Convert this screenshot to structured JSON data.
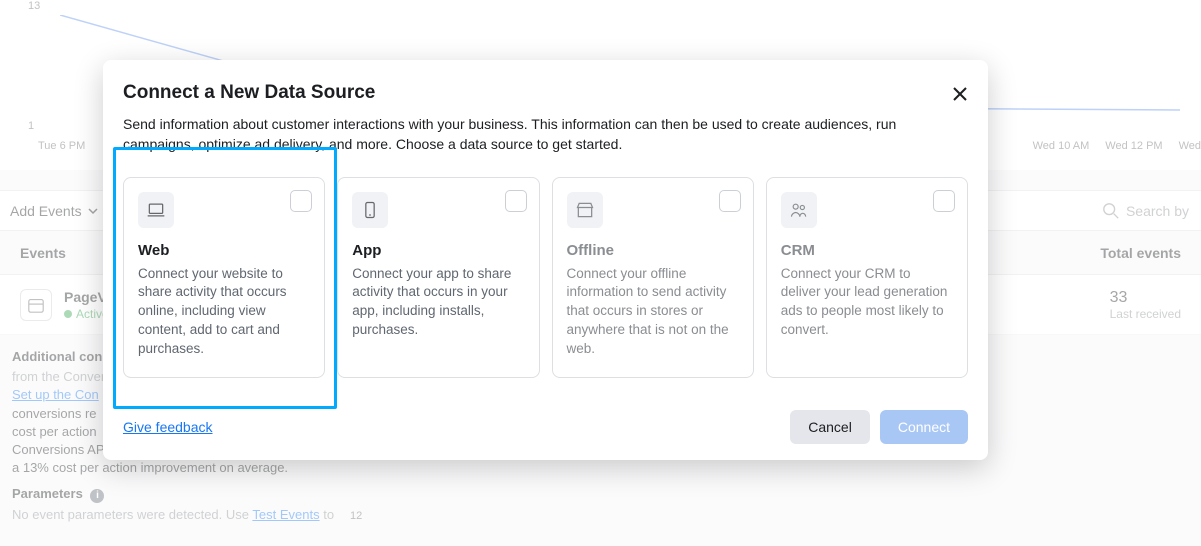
{
  "chart_data": {
    "type": "line",
    "y_ticks": [
      "13",
      "1"
    ],
    "x_ticks": [
      "Tue 6 PM",
      "Wed 10 AM",
      "Wed 12 PM",
      "Wed"
    ],
    "ylim": [
      1,
      13
    ]
  },
  "toolbar": {
    "add_events": "Add Events",
    "search_placeholder": "Search by"
  },
  "table": {
    "header_events": "Events",
    "header_total": "Total events",
    "row": {
      "name": "PageVi",
      "status": "Active",
      "count": "33",
      "sub": "Last received"
    }
  },
  "side": {
    "heading": "Additional con",
    "subheading": "from the Convers",
    "link": "Set up the Con",
    "body1": "conversions re",
    "body2": "cost per action",
    "body3": "Conversions API alongside the Meta Pixel saw",
    "body4": "a 13% cost per action improvement on average.",
    "params_heading": "Parameters",
    "params_body_pre": "No event parameters were detected. Use ",
    "params_link": "Test Events",
    "params_body_post": " to"
  },
  "modal": {
    "title": "Connect a New Data Source",
    "description": "Send information about customer interactions with your business. This information can then be used to create audiences, run campaigns, optimize ad delivery, and more. Choose a data source to get started.",
    "cards": {
      "web": {
        "title": "Web",
        "desc": "Connect your website to share activity that occurs online, including view content, add to cart and purchases."
      },
      "app": {
        "title": "App",
        "desc": "Connect your app to share activity that occurs in your app, including installs, purchases."
      },
      "offline": {
        "title": "Offline",
        "desc": "Connect your offline information to send activity that occurs in stores or anywhere that is not on the web."
      },
      "crm": {
        "title": "CRM",
        "desc": "Connect your CRM to deliver your lead generation ads to people most likely to convert."
      }
    },
    "feedback": "Give feedback",
    "cancel": "Cancel",
    "connect": "Connect"
  },
  "misc": {
    "twelve": "12"
  }
}
